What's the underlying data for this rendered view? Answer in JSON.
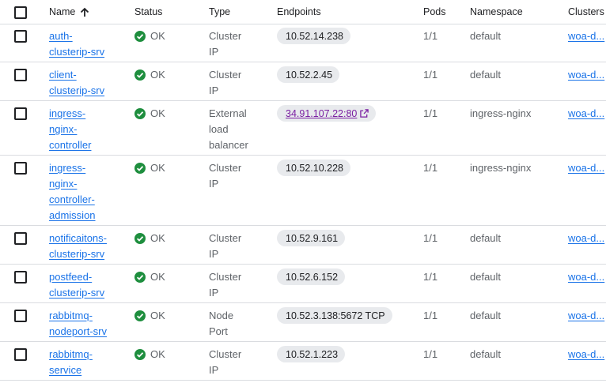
{
  "header": {
    "name": "Name",
    "status": "Status",
    "type": "Type",
    "endpoints": "Endpoints",
    "pods": "Pods",
    "namespace": "Namespace",
    "clusters": "Clusters"
  },
  "rows": [
    {
      "name_lines": [
        "auth-",
        "clusterip-srv"
      ],
      "status": "OK",
      "type_lines": [
        "Cluster",
        "IP"
      ],
      "endpoint": "10.52.14.238",
      "pods": "1/1",
      "namespace": "default",
      "cluster": "woa-d..."
    },
    {
      "name_lines": [
        "client-",
        "clusterip-srv"
      ],
      "status": "OK",
      "type_lines": [
        "Cluster",
        "IP"
      ],
      "endpoint": "10.52.2.45",
      "pods": "1/1",
      "namespace": "default",
      "cluster": "woa-d..."
    },
    {
      "name_lines": [
        "ingress-",
        "nginx-",
        "controller"
      ],
      "status": "OK",
      "type_lines": [
        "External",
        "load",
        "balancer"
      ],
      "endpoint": "34.91.107.22:80",
      "endpoint_link": true,
      "pods": "1/1",
      "namespace": "ingress-nginx",
      "cluster": "woa-d..."
    },
    {
      "name_lines": [
        "ingress-",
        "nginx-",
        "controller-",
        "admission"
      ],
      "status": "OK",
      "type_lines": [
        "Cluster",
        "IP"
      ],
      "endpoint": "10.52.10.228",
      "pods": "1/1",
      "namespace": "ingress-nginx",
      "cluster": "woa-d..."
    },
    {
      "name_lines": [
        "notificaitons-",
        "clusterip-srv"
      ],
      "status": "OK",
      "type_lines": [
        "Cluster",
        "IP"
      ],
      "endpoint": "10.52.9.161",
      "pods": "1/1",
      "namespace": "default",
      "cluster": "woa-d..."
    },
    {
      "name_lines": [
        "postfeed-",
        "clusterip-srv"
      ],
      "status": "OK",
      "type_lines": [
        "Cluster",
        "IP"
      ],
      "endpoint": "10.52.6.152",
      "pods": "1/1",
      "namespace": "default",
      "cluster": "woa-d..."
    },
    {
      "name_lines": [
        "rabbitmq-",
        "nodeport-srv"
      ],
      "status": "OK",
      "type_lines": [
        "Node",
        "Port"
      ],
      "endpoint": "10.52.3.138:5672 TCP",
      "pods": "1/1",
      "namespace": "default",
      "cluster": "woa-d..."
    },
    {
      "name_lines": [
        "rabbitmq-",
        "service"
      ],
      "status": "OK",
      "type_lines": [
        "Cluster",
        "IP"
      ],
      "endpoint": "10.52.1.223",
      "pods": "1/1",
      "namespace": "default",
      "cluster": "woa-d..."
    }
  ],
  "icons": {
    "sort": "arrow-up-icon",
    "status": "check-circle-icon",
    "external": "open-in-new-icon"
  },
  "colors": {
    "link": "#1a73e8",
    "ok_green": "#1e8e3e",
    "visited_link": "#7b1fa2",
    "chip_bg": "#e8eaed",
    "divider": "#dadce0"
  }
}
